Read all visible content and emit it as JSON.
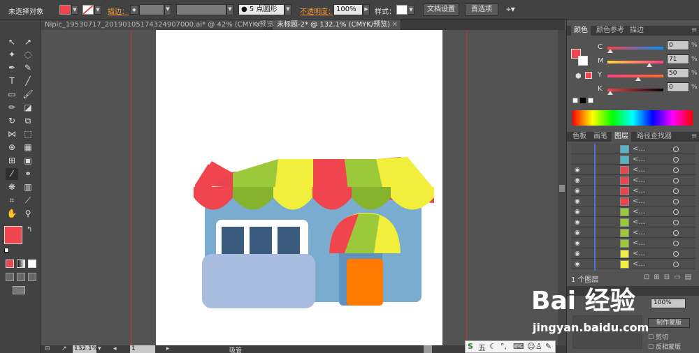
{
  "control_bar": {
    "selection_label": "未选择对象",
    "stroke_label": "描边：",
    "brush_label": "5 点圆形",
    "opacity_label": "不透明度：",
    "opacity_value": "100%",
    "style_label": "样式：",
    "doc_setup": "文档设置",
    "preferences": "首选项",
    "fill_color": "#f0454f"
  },
  "tabs": [
    {
      "label": "Nipic_19530717_20190105174324907000.ai* @ 42% (CMYK/预览)",
      "close": "✕"
    },
    {
      "label": "未标题-2* @ 132.1% (CMYK/预览)",
      "close": "✕"
    }
  ],
  "color_panel": {
    "tabs": [
      "颜色",
      "颜色参考",
      "描边"
    ],
    "channels": [
      {
        "key": "C",
        "value": "0",
        "pct": "%",
        "pos": 0.0
      },
      {
        "key": "M",
        "value": "71",
        "pct": "%",
        "pos": 0.71
      },
      {
        "key": "Y",
        "value": "50",
        "pct": "%",
        "pos": 0.5
      },
      {
        "key": "K",
        "value": "0",
        "pct": "%",
        "pos": 0.0
      }
    ]
  },
  "layers_panel": {
    "tabs": [
      "色板",
      "画笔",
      "图层",
      "路径查找器"
    ],
    "rows": [
      {
        "name": "<...",
        "swatch": "#56b6c6"
      },
      {
        "name": "<...",
        "swatch": "#56b6c6"
      },
      {
        "name": "<...",
        "swatch": "#e8454f"
      },
      {
        "name": "<...",
        "swatch": "#e8454f"
      },
      {
        "name": "<...",
        "swatch": "#e8454f"
      },
      {
        "name": "<...",
        "swatch": "#e8454f"
      },
      {
        "name": "<...",
        "swatch": "#9bc93a"
      },
      {
        "name": "<...",
        "swatch": "#9bc93a"
      },
      {
        "name": "<...",
        "swatch": "#9bc93a"
      },
      {
        "name": "<...",
        "swatch": "#9bc93a"
      },
      {
        "name": "<...",
        "swatch": "#f1ef3b"
      },
      {
        "name": "<...",
        "swatch": "#f1ef3b"
      }
    ],
    "footer": "1 个图层"
  },
  "transparency": {
    "value": "100%",
    "make_mask": "制作蒙版",
    "clip": "剪切",
    "invert_mask": "反相蒙版"
  },
  "status_bar": {
    "zoom": "132.1%",
    "page": "1",
    "tool": "吸管"
  },
  "watermark": {
    "logo": "Bai  经验",
    "url": "jingyan.baidu.com"
  },
  "ime": {
    "mode": "五"
  }
}
